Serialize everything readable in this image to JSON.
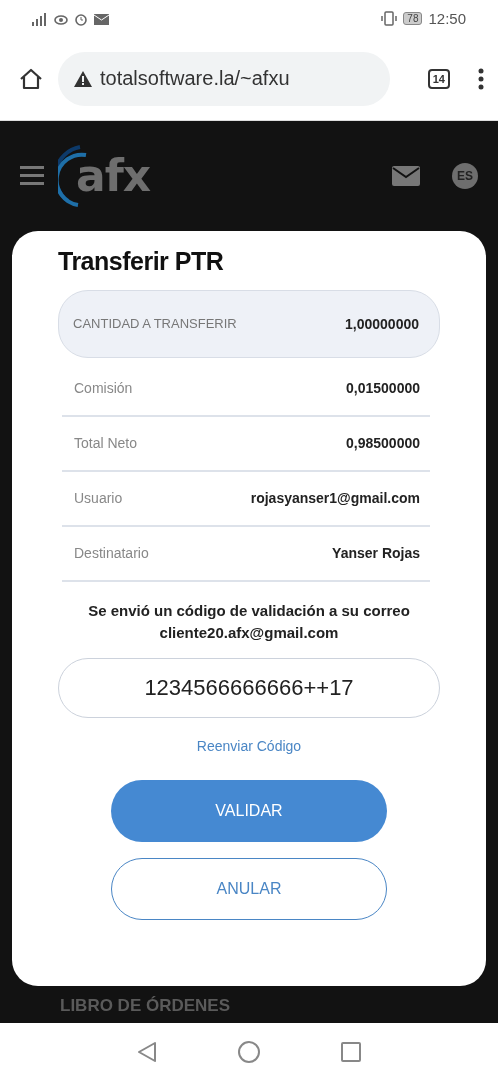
{
  "status_bar": {
    "battery": "78",
    "time": "12:50"
  },
  "browser": {
    "url": "totalsoftware.la/~afxu",
    "tab_count": "14"
  },
  "app_header": {
    "logo": "afx",
    "language": "ES"
  },
  "dialog": {
    "title": "Transferir PTR",
    "amount": {
      "label": "CANTIDAD A TRANSFERIR",
      "value": "1,00000000"
    },
    "rows": [
      {
        "label": "Comisión",
        "value": "0,01500000"
      },
      {
        "label": "Total Neto",
        "value": "0,98500000"
      },
      {
        "label": "Usuario",
        "value": "rojasyanser1@gmail.com"
      },
      {
        "label": "Destinatario",
        "value": "Yanser Rojas"
      }
    ],
    "message": "Se envió un código de validación a su correo cliente20.afx@gmail.com",
    "code": {
      "value": "1234566666666++17"
    },
    "resend_link": "Reenviar Código",
    "buttons": [
      {
        "label": "VALIDAR",
        "kind": "primary"
      },
      {
        "label": "ANULAR",
        "kind": "secondary"
      }
    ]
  },
  "background_section": {
    "title": "LIBRO DE ÓRDENES"
  }
}
